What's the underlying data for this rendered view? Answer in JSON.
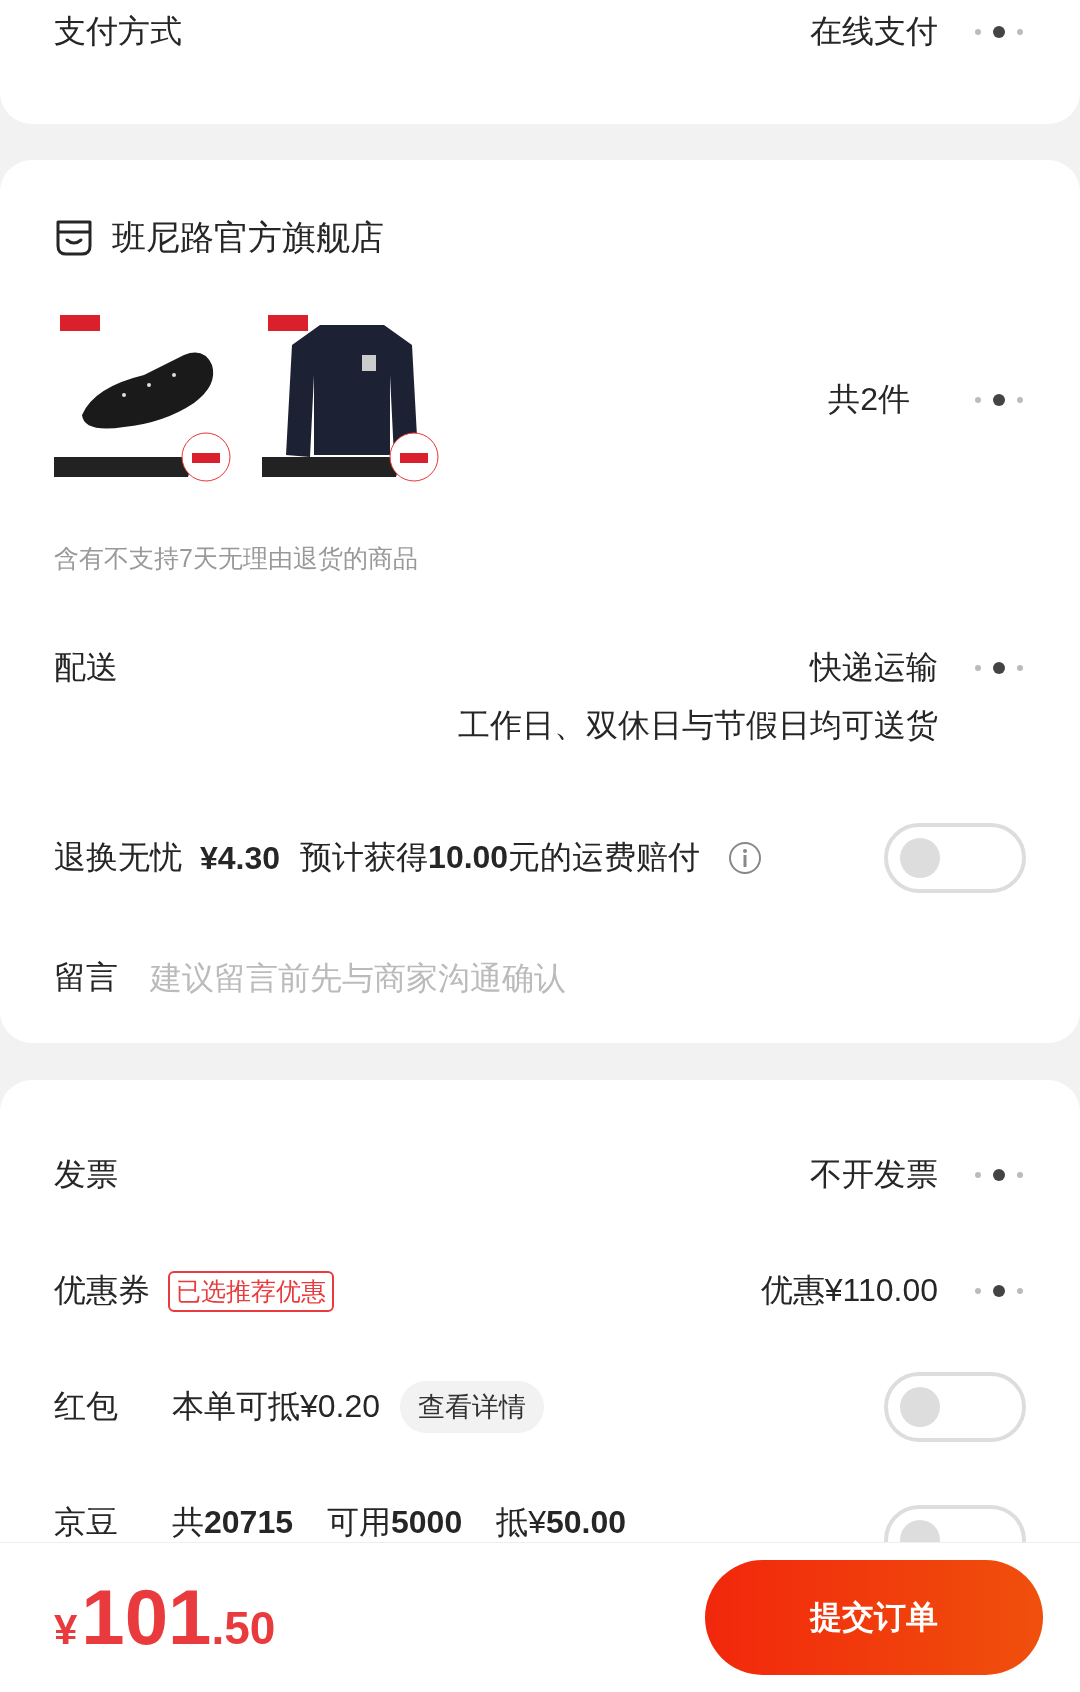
{
  "payment": {
    "label": "支付方式",
    "value": "在线支付"
  },
  "store": {
    "name": "班尼路官方旗舰店",
    "count": "共2件",
    "notice": "含有不支持7天无理由退货的商品",
    "delivery": {
      "label": "配送",
      "value": "快递运输",
      "detail": "工作日、双休日与节假日均可送货"
    },
    "return_insurance": {
      "label": "退换无忧",
      "price": "¥4.30",
      "description": "预计获得**10.00**元的运费赔付",
      "on": false
    },
    "message": {
      "label": "留言",
      "placeholder": "建议留言前先与商家沟通确认"
    }
  },
  "invoice": {
    "label": "发票",
    "value": "不开发票"
  },
  "coupon": {
    "label": "优惠券",
    "tag": "已选推荐优惠",
    "value": "优惠¥110.00"
  },
  "red_packet": {
    "label": "红包",
    "value": "本单可抵¥0.20",
    "button": "查看详情",
    "on": false
  },
  "jd_beans": {
    "label": "京豆",
    "total": "共**20715**",
    "usable": "可用**5000**",
    "deduct": "抵¥**50.00**",
    "on": false
  },
  "footer": {
    "currency": "¥",
    "price_integer": "101",
    "price_decimal": ".50",
    "submit": "提交订单"
  }
}
